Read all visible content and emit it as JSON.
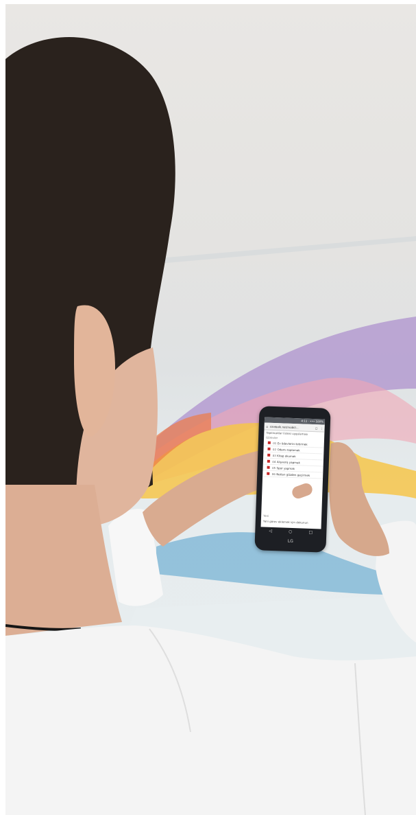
{
  "scene": {
    "description_items": [
      "person-back-view",
      "smartphone",
      "rainbow-wave-wall"
    ]
  },
  "phone": {
    "status_bar": "4:11 · ••• 100%",
    "url_bar": {
      "home_icon": "home-icon",
      "url": "sinebalk.net/mobil/...",
      "tabs_icon": "tabs-icon",
      "menu_icon": "menu-icon"
    },
    "subtitle": "Yapılacaklar listesi uygulaması",
    "section_label": "Görevler",
    "rows": [
      {
        "num": "01",
        "label": "Ev ödevlerini bitirmek"
      },
      {
        "num": "02",
        "label": "Odamı toplamak"
      },
      {
        "num": "03",
        "label": "Kitap okumak"
      },
      {
        "num": "04",
        "label": "Alışveriş yapmak"
      },
      {
        "num": "05",
        "label": "Spor yapmak"
      },
      {
        "num": "06",
        "label": "Notları gözden geçirmek"
      }
    ],
    "footer_label": "Yeni",
    "footer_text": "Yeni görev eklemek için dokunun",
    "nav": {
      "back": "◁",
      "home": "○",
      "recents": "□"
    },
    "brand": "LG",
    "colors": {
      "checkbox": "#c62828",
      "statusbar": "#5b5f66"
    }
  }
}
